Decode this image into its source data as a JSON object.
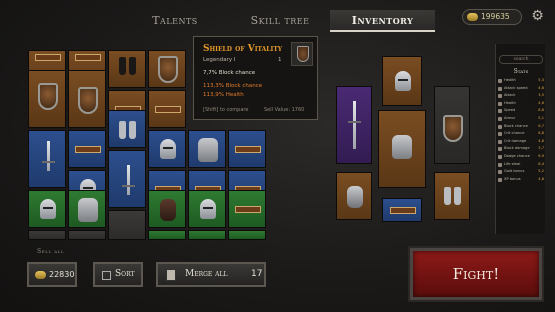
{
  "nav": {
    "tabs": [
      "Talents",
      "Skill tree",
      "Inventory"
    ],
    "active_tab": "Inventory",
    "currency": "199635"
  },
  "tooltip": {
    "title": "Shield of Vitality",
    "rarity": "Legendary I",
    "level": "1",
    "main_stat": "7,7% Block chance",
    "bonus_1": "113,3% Block chance",
    "bonus_2": "113,9% Health",
    "compare": "[Shift] to compare",
    "sell_value": "Sell Value: 1760"
  },
  "stats": {
    "search_placeholder": "search",
    "title": "Stats",
    "rows": [
      {
        "name": "Health",
        "value": "5,3"
      },
      {
        "name": "Attack speed",
        "value": "4,8"
      },
      {
        "name": "Attack",
        "value": "3,5"
      },
      {
        "name": "Health",
        "value": "4,6"
      },
      {
        "name": "Speed",
        "value": "8,8"
      },
      {
        "name": "Armor",
        "value": "5,1"
      },
      {
        "name": "Block chance",
        "value": "6,7"
      },
      {
        "name": "Crit chance",
        "value": "6,8"
      },
      {
        "name": "Crit damage",
        "value": "4,8"
      },
      {
        "name": "Block damage",
        "value": "3,7"
      },
      {
        "name": "Dodge chance",
        "value": "6,9"
      },
      {
        "name": "Life steal",
        "value": "8,4"
      },
      {
        "name": "Gold bonus",
        "value": "5,2"
      },
      {
        "name": "XP bonus",
        "value": "4,8"
      }
    ]
  },
  "bottom": {
    "sell_all": "Sell all",
    "gold_value": "22830",
    "sort": "Sort",
    "merge_all": "Merge all",
    "merge_count": "17",
    "fight": "Fight!"
  }
}
